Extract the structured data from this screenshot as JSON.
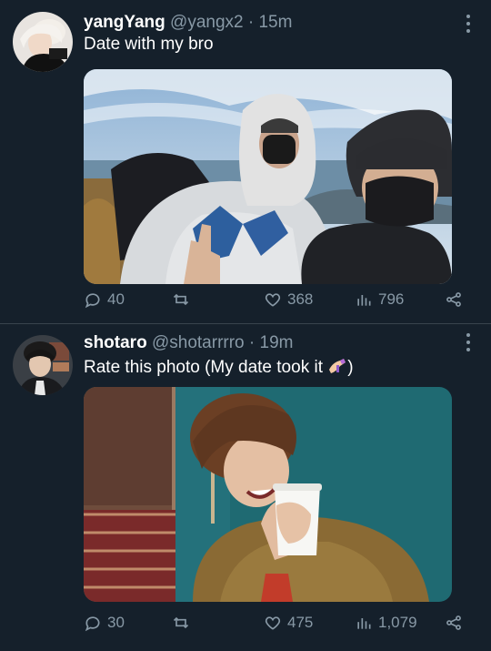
{
  "tweets": [
    {
      "name": "yangYang",
      "handle": "@yangx2",
      "separator": "·",
      "time": "15m",
      "text": "Date with my bro",
      "stats": {
        "replies": "40",
        "retweets": "",
        "likes": "368",
        "views": "796"
      }
    },
    {
      "name": "shotaro",
      "handle": "@shotarrrro",
      "separator": "·",
      "time": "19m",
      "text_before": "Rate this photo (My date took it ",
      "text_after": ")",
      "stats": {
        "replies": "30",
        "retweets": "",
        "likes": "475",
        "views": "1,079"
      }
    }
  ],
  "icons": {
    "more": "more-vertical-icon",
    "reply": "reply-icon",
    "retweet": "retweet-icon",
    "like": "heart-icon",
    "views": "bar-chart-icon",
    "share": "share-icon",
    "emoji": "nail-polish-emoji-icon"
  },
  "colors": {
    "background": "#15202b",
    "divider": "#38444d",
    "secondary_text": "#8899a6",
    "primary_text": "#ffffff"
  }
}
